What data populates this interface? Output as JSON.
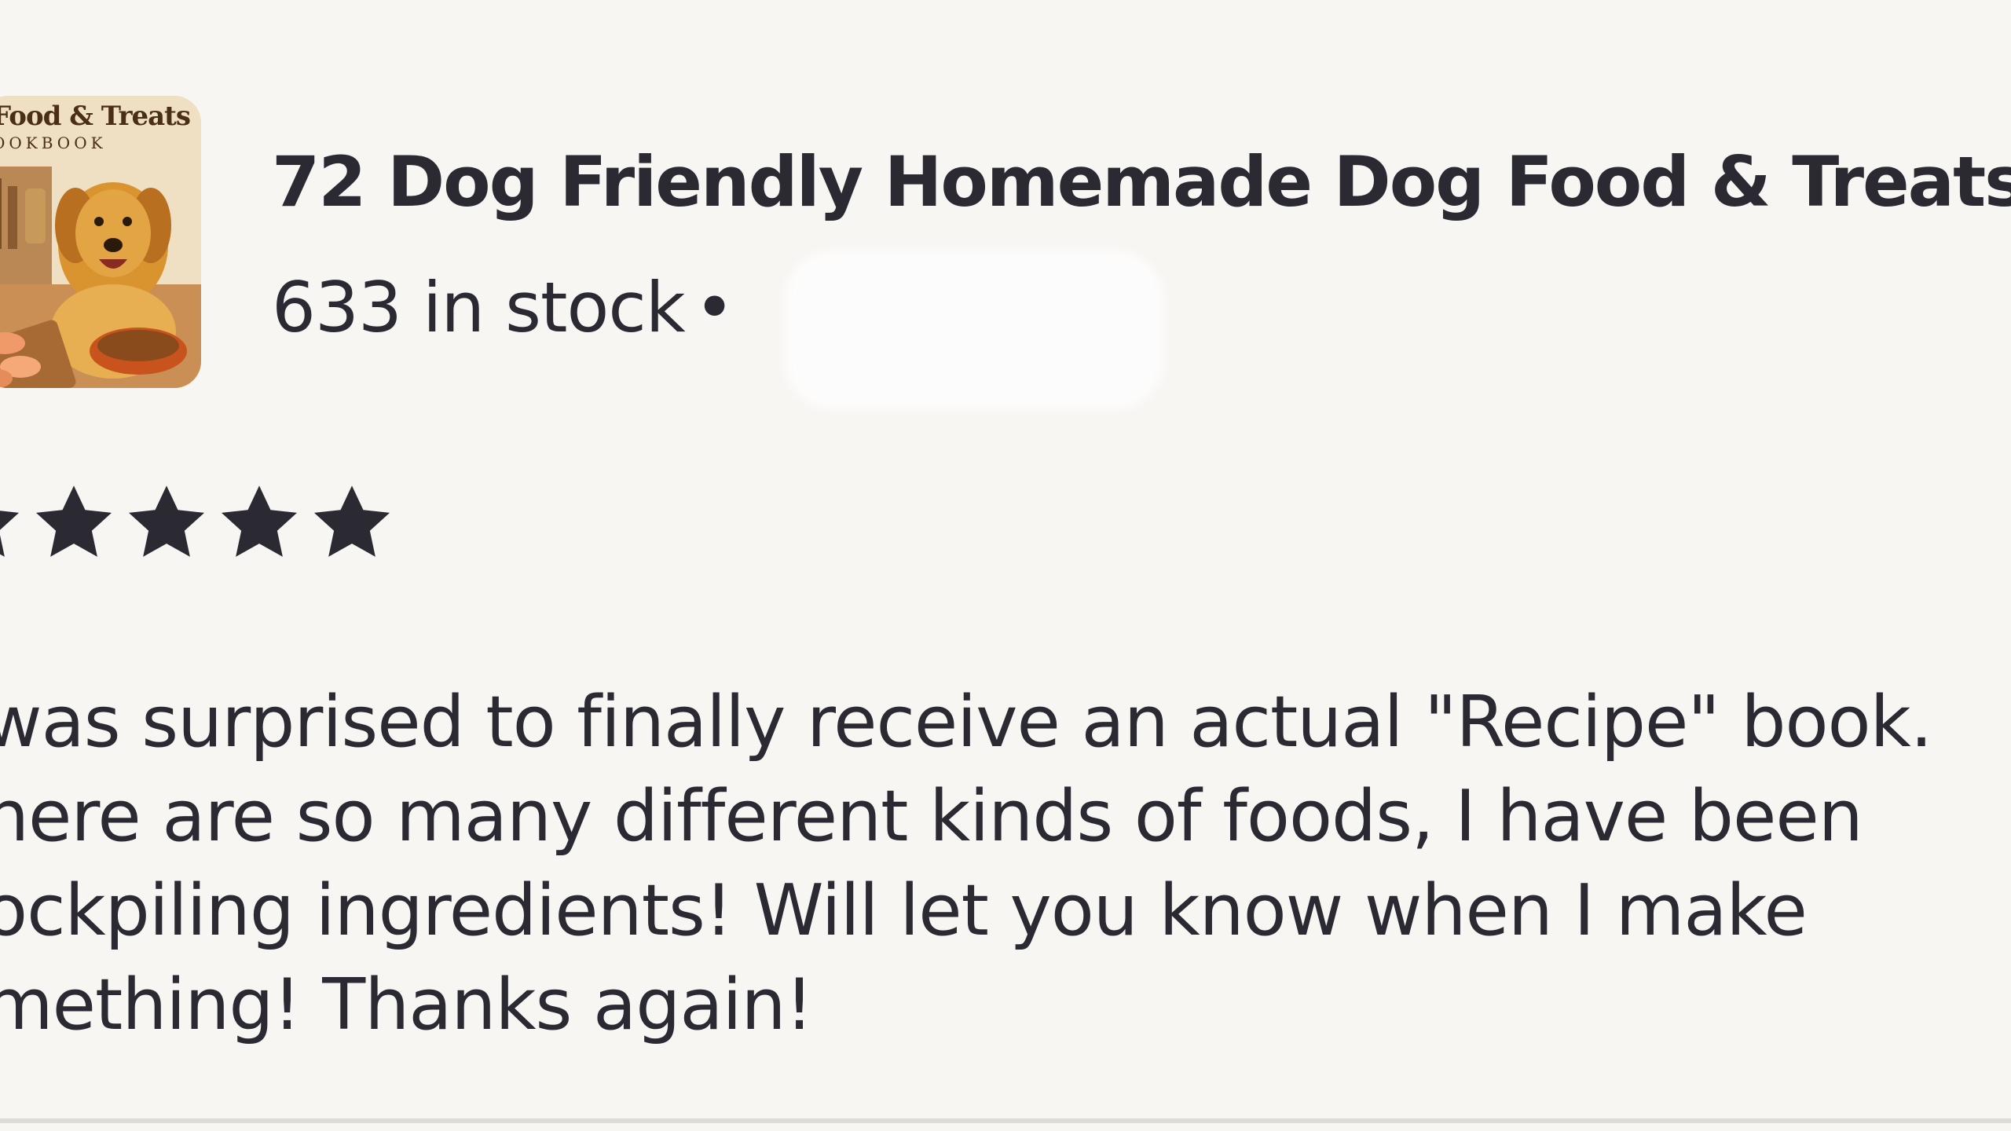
{
  "listing": {
    "thumbnail": {
      "cover_title": "Food & Treats",
      "cover_subtitle": "OOKBOOK",
      "icon": "dog-cookbook-cover-image"
    },
    "title": "72 Dog Friendly Homemade Dog Food & Treats",
    "stock": "633 in stock",
    "separator": "•"
  },
  "review": {
    "rating": 5,
    "rating_max": 5,
    "star_icon": "star-icon",
    "lines": [
      "was surprised to finally receive an actual \"Recipe\" book.",
      "here are so many different kinds of foods, I have been",
      "ockpiling ingredients! Will let you know when I make",
      "mething! Thanks again!"
    ]
  },
  "colors": {
    "background": "#f8f6f3",
    "text": "#2b2a33",
    "star": "#2b2a33",
    "divider": "#dedbd6"
  }
}
